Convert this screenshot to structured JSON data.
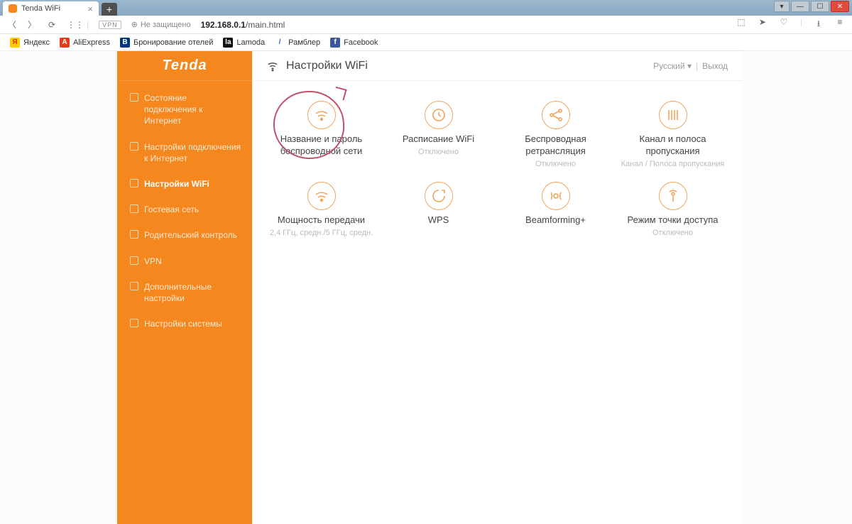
{
  "browser": {
    "tab_title": "Tenda WiFi",
    "url_host": "192.168.0.1",
    "url_path": "/main.html",
    "not_secure": "Не защищено",
    "vpn": "VPN"
  },
  "bookmarks": [
    {
      "label": "Яндекс",
      "bg": "#ffcc00",
      "fg": "#d62d20",
      "t": "Я"
    },
    {
      "label": "AliExpress",
      "bg": "#e43c1a",
      "fg": "#fff",
      "t": "A"
    },
    {
      "label": "Бронирование отелей",
      "bg": "#003580",
      "fg": "#fff",
      "t": "B"
    },
    {
      "label": "Lamoda",
      "bg": "#111",
      "fg": "#fff",
      "t": "la"
    },
    {
      "label": "Рамблер",
      "bg": "#fff",
      "fg": "#2a5fd8",
      "t": "/"
    },
    {
      "label": "Facebook",
      "bg": "#3b5998",
      "fg": "#fff",
      "t": "f"
    }
  ],
  "sidebar": {
    "brand": "Tenda",
    "items": [
      {
        "label": "Состояние подключения к Интернет"
      },
      {
        "label": "Настройки подключения к Интернет"
      },
      {
        "label": "Настройки WiFi"
      },
      {
        "label": "Гостевая сеть"
      },
      {
        "label": "Родительский контроль"
      },
      {
        "label": "VPN"
      },
      {
        "label": "Дополнительные настройки"
      },
      {
        "label": "Настройки системы"
      }
    ],
    "active_index": 2
  },
  "header": {
    "title": "Настройки WiFi",
    "language": "Русский",
    "logout": "Выход"
  },
  "tiles": [
    {
      "title": "Название и пароль беспроводной сети",
      "sub": "",
      "mark": true,
      "icon": "wifi"
    },
    {
      "title": "Расписание WiFi",
      "sub": "Отключено",
      "icon": "clock"
    },
    {
      "title": "Беспроводная ретрансляция",
      "sub": "Отключено",
      "icon": "share"
    },
    {
      "title": "Канал и полоса пропускания",
      "sub": "Канал / Полоса пропускания",
      "icon": "bands"
    },
    {
      "title": "Мощность передачи",
      "sub": "2,4 ГГц, средн./5 ГГц, средн.",
      "icon": "wifi"
    },
    {
      "title": "WPS",
      "sub": "",
      "icon": "wps"
    },
    {
      "title": "Beamforming+",
      "sub": "",
      "icon": "beam"
    },
    {
      "title": "Режим точки доступа",
      "sub": "Отключено",
      "icon": "ap"
    }
  ]
}
